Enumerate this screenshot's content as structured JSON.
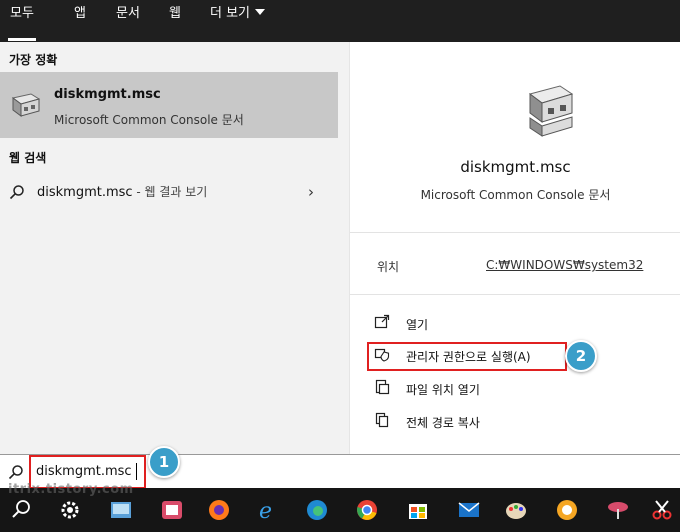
{
  "tabs": [
    {
      "label": "모두"
    },
    {
      "label": "앱"
    },
    {
      "label": "문서"
    },
    {
      "label": "웹"
    },
    {
      "label": "더 보기"
    }
  ],
  "best_match": {
    "section_title": "가장 정확",
    "title": "diskmgmt.msc",
    "subtitle": "Microsoft Common Console 문서"
  },
  "web_search": {
    "section_title": "웹 검색",
    "query": "diskmgmt.msc",
    "suffix": " - 웹 결과 보기"
  },
  "detail": {
    "name": "diskmgmt.msc",
    "type": "Microsoft Common Console 문서",
    "location_label": "위치",
    "location_value": "C:₩WINDOWS₩system32",
    "actions": [
      {
        "label": "열기",
        "icon": "open-icon"
      },
      {
        "label": "관리자 권한으로 실행(A)",
        "icon": "shield-icon"
      },
      {
        "label": "파일 위치 열기",
        "icon": "folder-icon"
      },
      {
        "label": "전체 경로 복사",
        "icon": "copy-icon"
      }
    ]
  },
  "search": {
    "value": "diskmgmt.msc"
  },
  "badges": {
    "step1": "1",
    "step2": "2"
  },
  "watermark": "itrix.tistory.com",
  "taskbar": {
    "items": [
      "search-icon",
      "settings-icon",
      "app-icon",
      "app-icon",
      "firefox-icon",
      "ie-icon",
      "edge-icon",
      "chrome-icon",
      "store-icon",
      "mail-icon",
      "paint-icon",
      "app-icon",
      "app-icon",
      "snipping-icon"
    ]
  },
  "colors": {
    "accent_badge": "#3a9ec9",
    "highlight_box": "#e02020",
    "selected_row": "#c8c8c8"
  }
}
